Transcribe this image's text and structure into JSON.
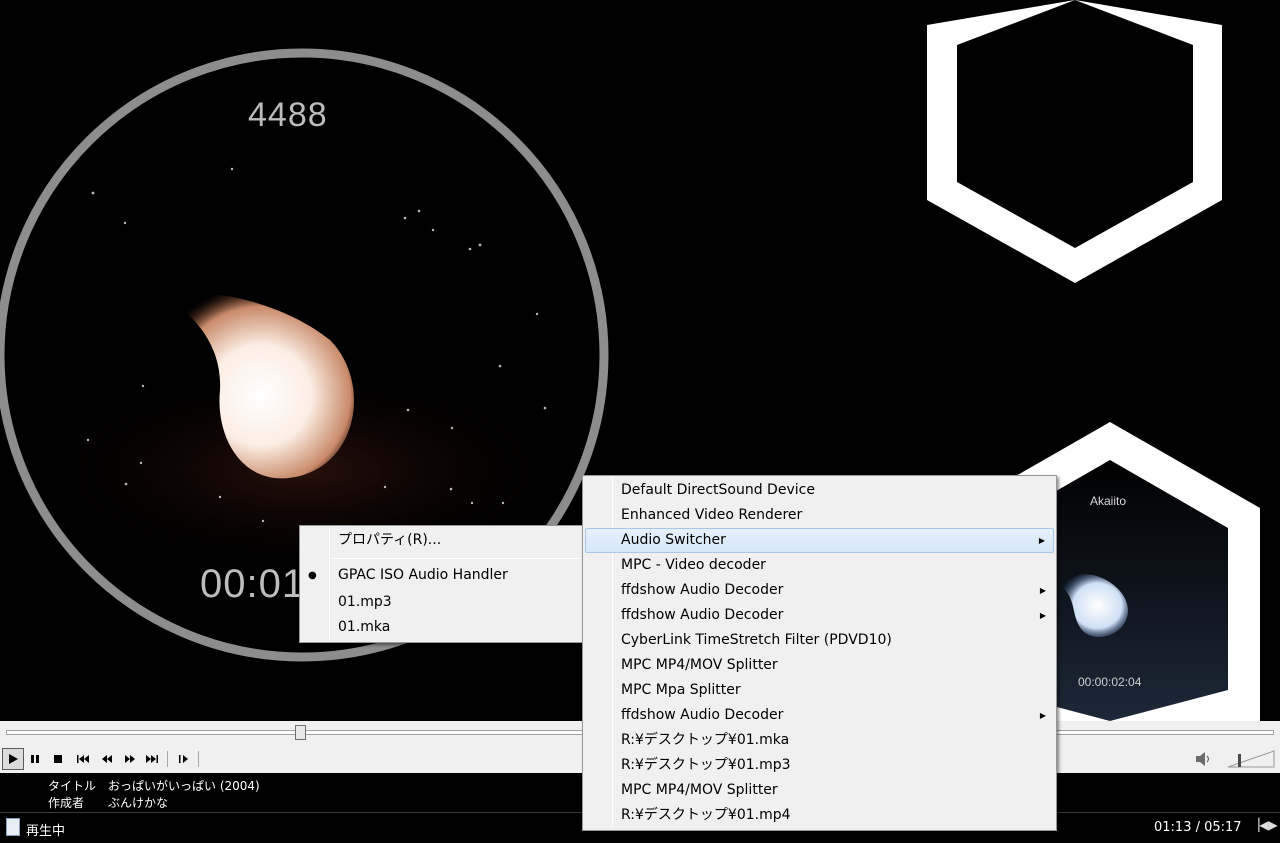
{
  "video": {
    "counter": "4488",
    "big_time": "00:01",
    "thumb_title": "Akaiito",
    "thumb_time": "00:00:02:04"
  },
  "seek": {
    "progress": 0.232
  },
  "controls": {
    "buttons": [
      "play",
      "pause",
      "stop",
      "prev",
      "rewind",
      "forward",
      "next",
      "frame-step"
    ]
  },
  "info": {
    "title_label": "タイトル",
    "title_value": "おっぱいがいっぱい (2004)",
    "author_label": "作成者",
    "author_value": "ぶんけかな"
  },
  "status": {
    "state": "再生中",
    "time": "01:13 / 05:17"
  },
  "main_menu": {
    "properties": "プロパティ(R)...",
    "items": [
      {
        "label": "GPAC ISO Audio Handler",
        "selected": true
      },
      {
        "label": "01.mp3",
        "selected": false
      },
      {
        "label": "01.mka",
        "selected": false
      }
    ]
  },
  "filters_menu": {
    "items": [
      {
        "label": "Default DirectSound Device",
        "submenu": false
      },
      {
        "label": "Enhanced Video Renderer",
        "submenu": false
      },
      {
        "label": "Audio Switcher",
        "submenu": true,
        "highlighted": true
      },
      {
        "label": "MPC - Video decoder",
        "submenu": false
      },
      {
        "label": "ffdshow Audio Decoder",
        "submenu": true
      },
      {
        "label": "ffdshow Audio Decoder",
        "submenu": true
      },
      {
        "label": "CyberLink TimeStretch Filter (PDVD10)",
        "submenu": false
      },
      {
        "label": "MPC MP4/MOV Splitter",
        "submenu": false
      },
      {
        "label": "MPC Mpa Splitter",
        "submenu": false
      },
      {
        "label": "ffdshow Audio Decoder",
        "submenu": true
      },
      {
        "label": "R:¥デスクトップ¥01.mka",
        "submenu": false
      },
      {
        "label": "R:¥デスクトップ¥01.mp3",
        "submenu": false
      },
      {
        "label": "MPC MP4/MOV Splitter",
        "submenu": false
      },
      {
        "label": "R:¥デスクトップ¥01.mp4",
        "submenu": false
      }
    ]
  }
}
